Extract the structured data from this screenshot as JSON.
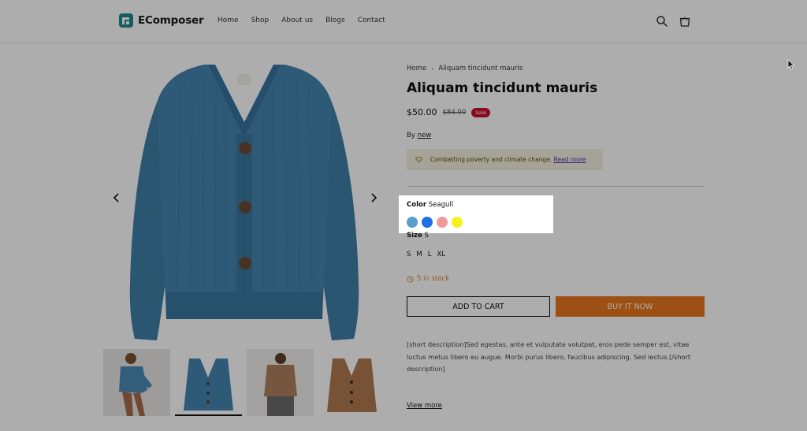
{
  "header": {
    "brand": "EComposer",
    "nav": [
      "Home",
      "Shop",
      "About us",
      "Blogs",
      "Contact"
    ]
  },
  "breadcrumb": {
    "home": "Home",
    "separator": "›",
    "current": "Aliquam tincidunt mauris"
  },
  "product": {
    "title": "Aliquam tincidunt mauris",
    "price": "$50.00",
    "compare_price": "$84.00",
    "badge": "Sale",
    "by_prefix": "By",
    "by_link": "new",
    "notice_text": "Combatting poverty and climate change.",
    "notice_link": "Read more",
    "color_label": "Color",
    "color_value": "Seagull",
    "swatches": [
      {
        "name": "Seagull",
        "color": "#5b9ec9"
      },
      {
        "name": "Blue",
        "color": "#1f6fe8"
      },
      {
        "name": "Pink",
        "color": "#ef9a9a"
      },
      {
        "name": "Yellow",
        "color": "#f6f21c"
      }
    ],
    "size_label": "Size",
    "size_value": "S",
    "sizes": [
      "S",
      "M",
      "L",
      "XL"
    ],
    "stock": "5 in stock",
    "add_to_cart": "ADD TO CART",
    "buy_now": "BUY IT NOW",
    "description": "[short description]Sed egestas, ante et vulputate volutpat, eros pede semper est, vitae luctus metus libero eu augue. Morbi purus libero, faucibus adipiscing. Sed lectus.[/short description]",
    "view_more": "View more"
  },
  "colors": {
    "accent": "#e8761c",
    "sale": "#c8102e",
    "stock": "#d9822b",
    "cardigan": "#3f7fa9"
  }
}
